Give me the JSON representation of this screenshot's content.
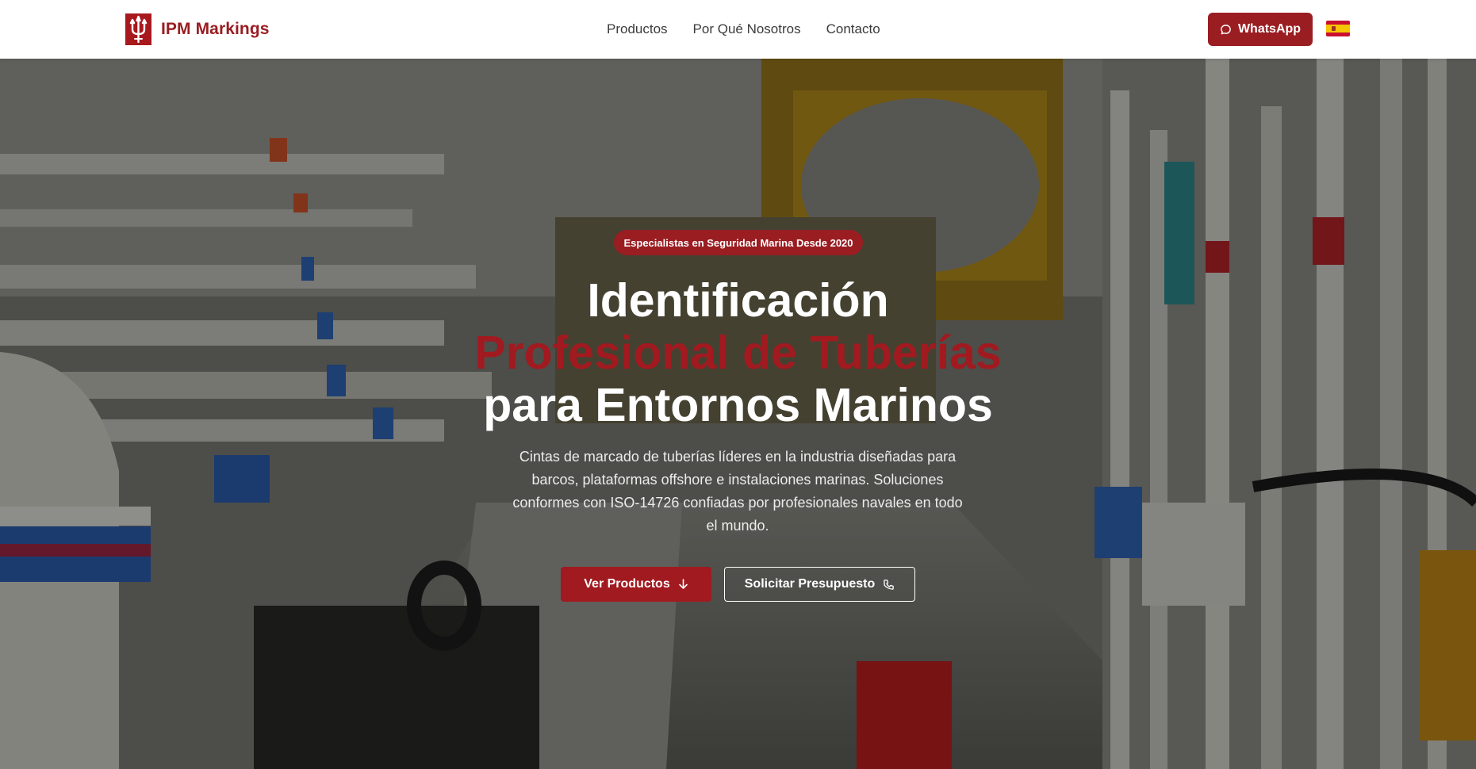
{
  "header": {
    "brand_name": "IPM Markings",
    "logo_icon": "trident-icon",
    "nav": [
      {
        "label": "Productos"
      },
      {
        "label": "Por Qué Nosotros"
      },
      {
        "label": "Contacto"
      }
    ],
    "whatsapp_label": "WhatsApp",
    "whatsapp_icon": "chat-bubble-icon",
    "language_flag": "spain-flag-icon"
  },
  "hero": {
    "badge": "Especialistas en Seguridad Marina Desde 2020",
    "title_line1": "Identificación",
    "title_line2": "Profesional de Tuberías",
    "title_line3": "para Entornos Marinos",
    "description": "Cintas de marcado de tuberías líderes en la industria diseñadas para barcos, plataformas offshore e instalaciones marinas. Soluciones conformes con ISO-14726 confiadas por profesionales navales en todo el mundo.",
    "primary_button": "Ver Productos",
    "primary_icon": "arrow-down-icon",
    "secondary_button": "Solicitar Presupuesto",
    "secondary_icon": "phone-icon"
  },
  "colors": {
    "brand_red": "#9a1d22",
    "accent_red": "#a11a20",
    "nav_text": "#3b3b3b"
  }
}
